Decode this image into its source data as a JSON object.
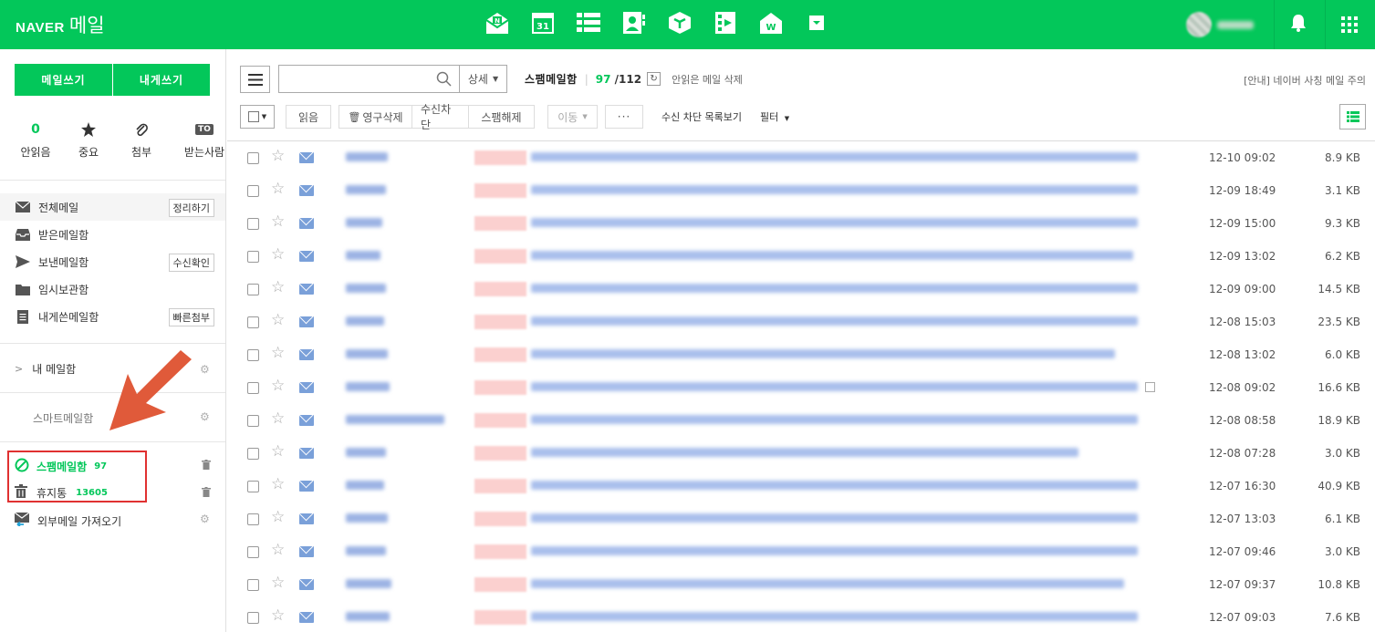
{
  "header": {
    "logo_brand": "NAVER",
    "logo_service": "메일",
    "apps": [
      "mail-app-icon",
      "calendar-app-icon",
      "list-app-icon",
      "contacts-app-icon",
      "box-app-icon",
      "media-app-icon",
      "office-app-icon",
      "more-apps-icon"
    ],
    "calendar_day": "31",
    "office_letter": "W",
    "colors": {
      "brand": "#03c75a",
      "alert_red": "#e03131"
    }
  },
  "sidebar": {
    "write_mail": "메일쓰기",
    "write_self": "내게쓰기",
    "quick": [
      {
        "value": "0",
        "label": "안읽음"
      },
      {
        "icon": "star-icon",
        "label": "중요"
      },
      {
        "icon": "paperclip-icon",
        "label": "첨부"
      },
      {
        "icon": "to-badge-icon",
        "badge": "TO",
        "label": "받는사람"
      }
    ],
    "folders": [
      {
        "label": "전체메일",
        "tag": "정리하기"
      },
      {
        "label": "받은메일함",
        "tag": ""
      },
      {
        "label": "보낸메일함",
        "tag": "수신확인"
      },
      {
        "label": "임시보관함",
        "tag": ""
      },
      {
        "label": "내게쓴메일함",
        "tag": "빠른첨부"
      }
    ],
    "my_mailbox": "내 메일함",
    "smart_mailbox": "스마트메일함",
    "spam": {
      "label": "스팸메일함",
      "count": "97"
    },
    "trash": {
      "label": "휴지통",
      "count": "13605"
    },
    "external": "외부메일 가져오기"
  },
  "toolbar": {
    "search_placeholder": "",
    "detail_label": "상세",
    "folder_name": "스팸메일함",
    "unread_count": "97",
    "total_count": "112",
    "delete_unread": "안읽은 메일 삭제",
    "notice": "[안내] 네이버 사칭 메일 주의",
    "read_btn": "읽음",
    "perm_delete_btn": "영구삭제",
    "block_btn": "수신차단",
    "unspam_btn": "스팸해제",
    "move_btn": "이동",
    "more_btn": "···",
    "blocklist_link": "수신 차단 목록보기",
    "filter_link": "필터"
  },
  "mails": [
    {
      "date": "12-10 09:02",
      "size": "8.9 KB"
    },
    {
      "date": "12-09 18:49",
      "size": "3.1 KB"
    },
    {
      "date": "12-09 15:00",
      "size": "9.3 KB"
    },
    {
      "date": "12-09 13:02",
      "size": "6.2 KB"
    },
    {
      "date": "12-09 09:00",
      "size": "14.5 KB"
    },
    {
      "date": "12-08 15:03",
      "size": "23.5 KB"
    },
    {
      "date": "12-08 13:02",
      "size": "6.0 KB"
    },
    {
      "date": "12-08 09:02",
      "size": "16.6 KB"
    },
    {
      "date": "12-08 08:58",
      "size": "18.9 KB"
    },
    {
      "date": "12-08 07:28",
      "size": "3.0 KB"
    },
    {
      "date": "12-07 16:30",
      "size": "40.9 KB"
    },
    {
      "date": "12-07 13:03",
      "size": "6.1 KB"
    },
    {
      "date": "12-07 09:46",
      "size": "3.0 KB"
    },
    {
      "date": "12-07 09:37",
      "size": "10.8 KB"
    },
    {
      "date": "12-07 09:03",
      "size": "7.6 KB"
    }
  ]
}
